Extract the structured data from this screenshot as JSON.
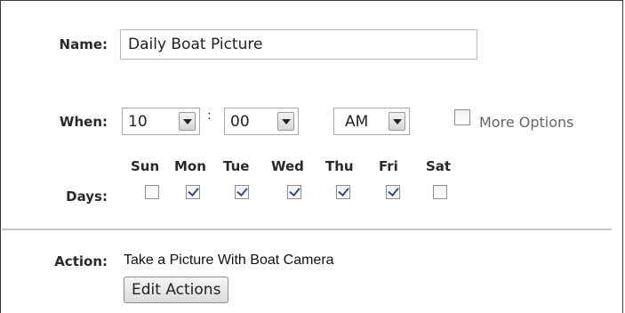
{
  "labels": {
    "name": "Name:",
    "when": "When:",
    "days": "Days:",
    "action": "Action:"
  },
  "name": {
    "value": "Daily Boat Picture"
  },
  "when": {
    "hour": "10",
    "separator": ":",
    "minute": "00",
    "ampm": "AM",
    "more_options": {
      "label": "More Options",
      "checked": false
    }
  },
  "days": [
    {
      "label": "Sun",
      "checked": false
    },
    {
      "label": "Mon",
      "checked": true
    },
    {
      "label": "Tue",
      "checked": true
    },
    {
      "label": "Wed",
      "checked": true
    },
    {
      "label": "Thu",
      "checked": true
    },
    {
      "label": "Fri",
      "checked": true
    },
    {
      "label": "Sat",
      "checked": false
    }
  ],
  "action": {
    "text": "Take a Picture With Boat Camera",
    "edit_label": "Edit Actions"
  }
}
